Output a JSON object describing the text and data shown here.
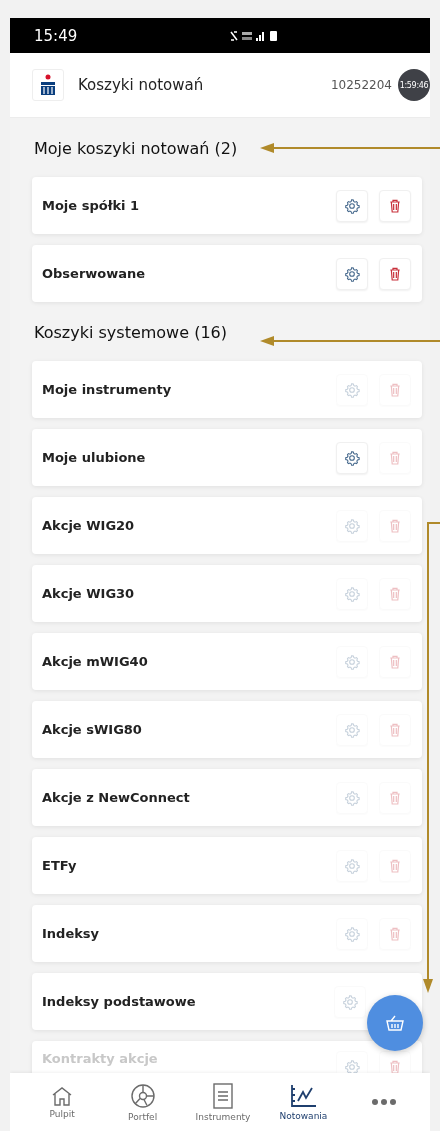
{
  "status_bar": {
    "time": "15:49"
  },
  "header": {
    "title": "Koszyki notowań",
    "account": "10252204",
    "timer": "1:59:46"
  },
  "sections": [
    {
      "title": "Moje koszyki notowań (2)",
      "rows": [
        {
          "name": "Moje spółki 1",
          "settings_enabled": true,
          "delete_enabled": true,
          "faded": false
        },
        {
          "name": "Obserwowane",
          "settings_enabled": true,
          "delete_enabled": true,
          "faded": false
        }
      ]
    },
    {
      "title": "Koszyki systemowe (16)",
      "rows": [
        {
          "name": "Moje instrumenty",
          "settings_enabled": false,
          "delete_enabled": false,
          "faded": false
        },
        {
          "name": "Moje ulubione",
          "settings_enabled": true,
          "delete_enabled": false,
          "faded": false
        },
        {
          "name": "Akcje WIG20",
          "settings_enabled": false,
          "delete_enabled": false,
          "faded": false
        },
        {
          "name": "Akcje WIG30",
          "settings_enabled": false,
          "delete_enabled": false,
          "faded": false
        },
        {
          "name": "Akcje mWIG40",
          "settings_enabled": false,
          "delete_enabled": false,
          "faded": false
        },
        {
          "name": "Akcje sWIG80",
          "settings_enabled": false,
          "delete_enabled": false,
          "faded": false
        },
        {
          "name": "Akcje z NewConnect",
          "settings_enabled": false,
          "delete_enabled": false,
          "faded": false
        },
        {
          "name": "ETFy",
          "settings_enabled": false,
          "delete_enabled": false,
          "faded": false
        },
        {
          "name": "Indeksy",
          "settings_enabled": false,
          "delete_enabled": false,
          "faded": false
        },
        {
          "name": "Indeksy podstawowe",
          "settings_enabled": false,
          "faded": false
        },
        {
          "name": "Kontrakty akcje",
          "settings_enabled": false,
          "delete_enabled": false,
          "faded": true
        }
      ]
    }
  ],
  "bottom_nav": [
    {
      "kind": "home",
      "label": "Pulpit",
      "selected": false
    },
    {
      "kind": "portfolio",
      "label": "Portfel",
      "selected": false
    },
    {
      "kind": "list",
      "label": "Instrumenty",
      "selected": false
    },
    {
      "kind": "chart",
      "label": "Notowania",
      "selected": true
    },
    {
      "kind": "more",
      "selected": false
    }
  ]
}
